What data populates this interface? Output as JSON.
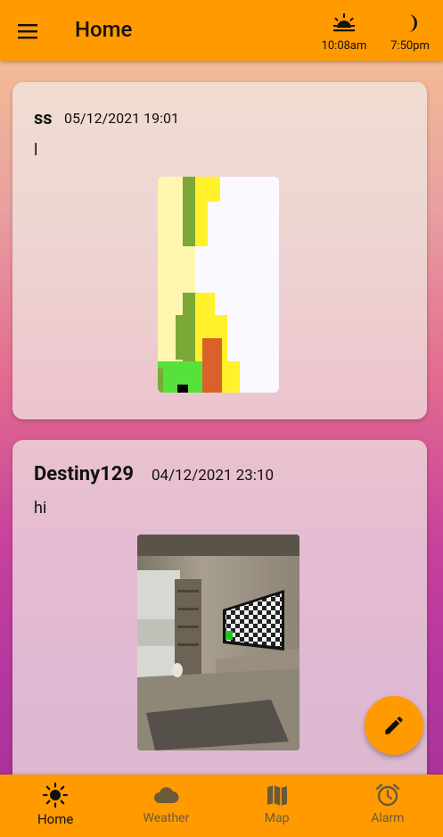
{
  "app_bar": {
    "title": "Home",
    "menu_icon": "hamburger-menu-icon",
    "sunrise": {
      "icon": "sunrise-icon",
      "time": "10:08am"
    },
    "sunset": {
      "icon": "moon-icon",
      "time": "7:50pm"
    }
  },
  "posts": [
    {
      "username": "ss",
      "date": "05/12/2021 19:01",
      "message": "l",
      "image": "pixel-drawing"
    },
    {
      "username": "Destiny129",
      "date": "04/12/2021 23:10",
      "message": "hi",
      "image": "living-room-photo"
    }
  ],
  "fab": {
    "icon": "edit-pencil-icon"
  },
  "bottom_nav": {
    "items": [
      {
        "label": "Home",
        "icon": "sun-icon",
        "active": true
      },
      {
        "label": "Weather",
        "icon": "cloud-icon",
        "active": false
      },
      {
        "label": "Map",
        "icon": "map-icon",
        "active": false
      },
      {
        "label": "Alarm",
        "icon": "alarm-clock-icon",
        "active": false
      }
    ]
  },
  "colors": {
    "accent": "#ff9a00",
    "inactive": "#6b5a3a"
  }
}
